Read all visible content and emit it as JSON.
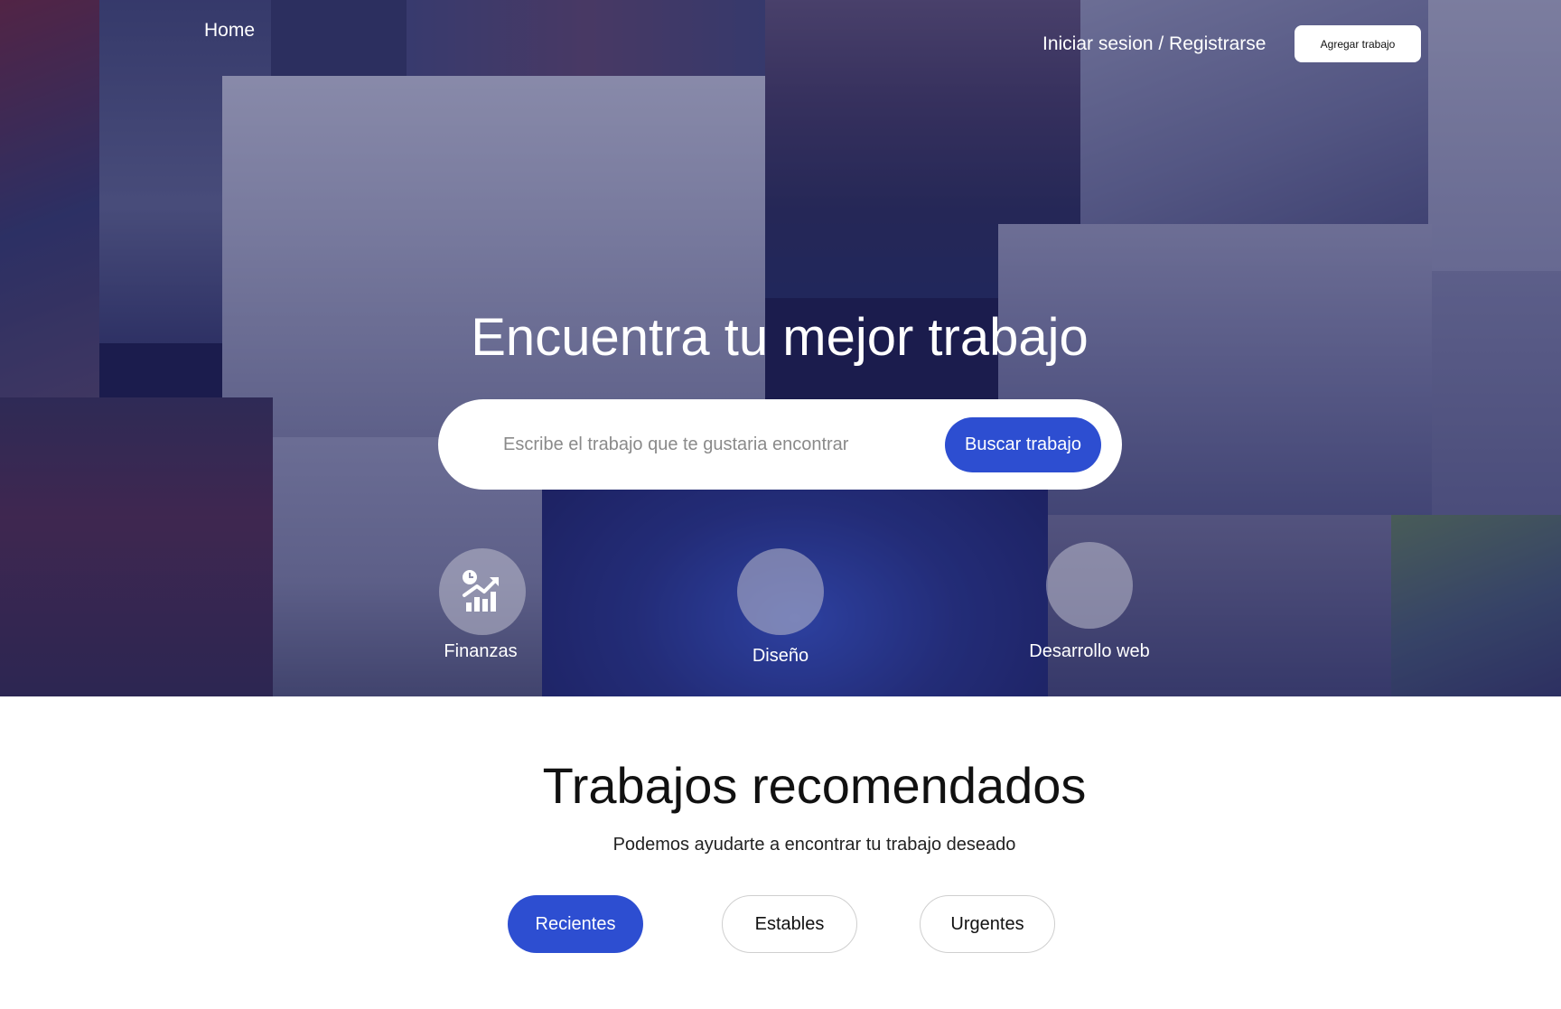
{
  "nav": {
    "home": "Home",
    "login": "Iniciar sesion / Registrarse",
    "add_job": "Agregar trabajo"
  },
  "hero": {
    "title": "Encuentra tu mejor trabajo",
    "search": {
      "placeholder": "Escribe el trabajo que te gustaria encontrar",
      "button": "Buscar trabajo"
    },
    "categories": [
      {
        "label": "Finanzas",
        "icon": "chart-growth-icon"
      },
      {
        "label": "Diseño",
        "icon": "design-icon"
      },
      {
        "label": "Desarrollo web",
        "icon": "web-dev-icon"
      }
    ]
  },
  "recommended": {
    "title": "Trabajos recomendados",
    "subtitle": "Podemos ayudarte a encontrar tu trabajo deseado",
    "filters": [
      "Recientes",
      "Estables",
      "Urgentes"
    ],
    "active_filter": "Recientes"
  },
  "colors": {
    "accent": "#2d4ed1",
    "hero_overlay": "#1a1c56"
  }
}
